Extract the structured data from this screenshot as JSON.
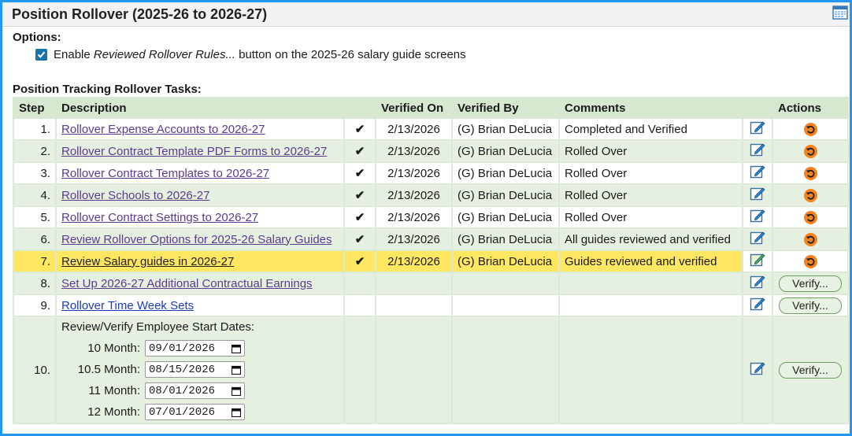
{
  "title": "Position Rollover (2025-26 to 2026-27)",
  "options": {
    "heading": "Options:",
    "checkbox_checked": true,
    "text_before": "Enable ",
    "text_italic": "Reviewed Rollover Rules...",
    "text_after": " button on the 2025-26 salary guide screens"
  },
  "tasks_heading": "Position Tracking Rollover Tasks:",
  "columns": {
    "step": "Step",
    "description": "Description",
    "verified_on": "Verified On",
    "verified_by": "Verified By",
    "comments": "Comments",
    "actions": "Actions"
  },
  "rows": [
    {
      "step": "1.",
      "description": "Rollover Expense Accounts to 2026-27",
      "checked": "✔",
      "verified_on": "2/13/2026",
      "verified_by": "(G) Brian DeLucia",
      "comment": "Completed and Verified",
      "action": "undo"
    },
    {
      "step": "2.",
      "description": "Rollover Contract Template PDF Forms to 2026-27",
      "checked": "✔",
      "verified_on": "2/13/2026",
      "verified_by": "(G) Brian DeLucia",
      "comment": "Rolled Over",
      "action": "undo"
    },
    {
      "step": "3.",
      "description": "Rollover Contract Templates to 2026-27",
      "checked": "✔",
      "verified_on": "2/13/2026",
      "verified_by": "(G) Brian DeLucia",
      "comment": "Rolled Over",
      "action": "undo"
    },
    {
      "step": "4.",
      "description": "Rollover Schools to 2026-27",
      "checked": "✔",
      "verified_on": "2/13/2026",
      "verified_by": "(G) Brian DeLucia",
      "comment": "Rolled Over",
      "action": "undo"
    },
    {
      "step": "5.",
      "description": "Rollover Contract Settings to 2026-27",
      "checked": "✔",
      "verified_on": "2/13/2026",
      "verified_by": "(G) Brian DeLucia",
      "comment": "Rolled Over",
      "action": "undo"
    },
    {
      "step": "6.",
      "description": "Review Rollover Options for 2025-26 Salary Guides",
      "checked": "✔",
      "verified_on": "2/13/2026",
      "verified_by": "(G) Brian DeLucia",
      "comment": "All guides reviewed and verified",
      "action": "undo"
    },
    {
      "step": "7.",
      "description": "Review Salary guides in 2026-27",
      "checked": "✔",
      "verified_on": "2/13/2026",
      "verified_by": "(G) Brian DeLucia",
      "comment": "Guides reviewed and verified",
      "action": "undo"
    },
    {
      "step": "8.",
      "description": "Set Up 2026-27 Additional Contractual Earnings",
      "checked": "",
      "verified_on": "",
      "verified_by": "",
      "comment": "",
      "action": "Verify..."
    },
    {
      "step": "9.",
      "description": "Rollover Time Week Sets",
      "checked": "",
      "verified_on": "",
      "verified_by": "",
      "comment": "",
      "action": "Verify..."
    }
  ],
  "row10": {
    "step": "10.",
    "description": "Review/Verify Employee Start Dates:",
    "dates": [
      {
        "label": "10 Month:",
        "value": "09/01/2026"
      },
      {
        "label": "10.5 Month:",
        "value": "08/15/2026"
      },
      {
        "label": "11 Month:",
        "value": "08/01/2026"
      },
      {
        "label": "12 Month:",
        "value": "07/01/2026"
      }
    ],
    "action": "Verify..."
  },
  "colors": {
    "frame": "#2196f3",
    "header_bg": "#d6e8cf",
    "highlight": "#ffe762",
    "undo": "#f58220"
  }
}
